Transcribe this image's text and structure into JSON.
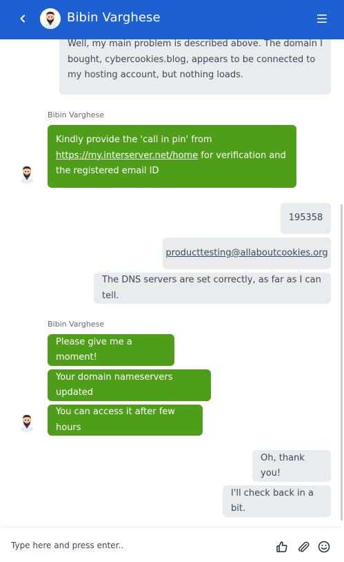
{
  "header": {
    "title": "Bibin Varghese",
    "back_icon": "chevron-left-icon",
    "menu_icon": "hamburger-menu-icon",
    "bg_color": "#1f5fd4"
  },
  "messages": {
    "m1": "Well, my main problem is described above. The domain I bought, cybercookies.blog, appears to be connected to my hosting account, but nothing loads.",
    "sender1": "Bibin Varghese",
    "m2_pre": "Kindly provide the 'call in pin' from",
    "m2_link": "https://my.interserver.net/home",
    "m2_post": "for verification and the registered email ID",
    "m3": "195358",
    "m4": "producttesting@allaboutcookies.org",
    "m5": "The DNS servers are set correctly, as far as I can tell.",
    "sender2": "Bibin Varghese",
    "m6": "Please give me a moment!",
    "m7": "Your domain nameservers updated",
    "m8": "You can access it after few hours",
    "m9": "Oh, thank you!",
    "m10": "I'll check back in a bit.",
    "agent_color": "#4f9e19",
    "user_color": "#e9ecef"
  },
  "composer": {
    "placeholder": "Type here and press enter..",
    "icons": [
      "thumbs-up-icon",
      "paperclip-icon",
      "emoji-icon"
    ]
  }
}
